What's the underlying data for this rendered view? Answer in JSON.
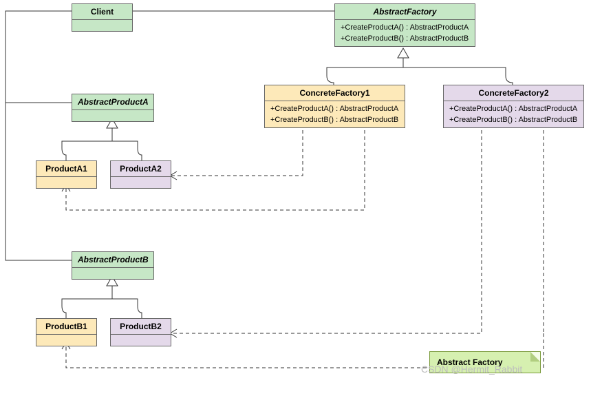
{
  "diagram": {
    "title_note": "Abstract Factory",
    "watermark": "CSDN @Hermit_Rabbit",
    "classes": {
      "client": {
        "name": "Client"
      },
      "abstractFactory": {
        "name": "AbstractFactory",
        "methods": [
          "+CreateProductA() : AbstractProductA",
          "+CreateProductB() : AbstractProductB"
        ]
      },
      "concreteFactory1": {
        "name": "ConcreteFactory1",
        "methods": [
          "+CreateProductA() : AbstractProductA",
          "+CreateProductB() : AbstractProductB"
        ]
      },
      "concreteFactory2": {
        "name": "ConcreteFactory2",
        "methods": [
          "+CreateProductA() : AbstractProductA",
          "+CreateProductB() : AbstractProductB"
        ]
      },
      "abstractProductA": {
        "name": "AbstractProductA"
      },
      "productA1": {
        "name": "ProductA1"
      },
      "productA2": {
        "name": "ProductA2"
      },
      "abstractProductB": {
        "name": "AbstractProductB"
      },
      "productB1": {
        "name": "ProductB1"
      },
      "productB2": {
        "name": "ProductB2"
      }
    }
  }
}
